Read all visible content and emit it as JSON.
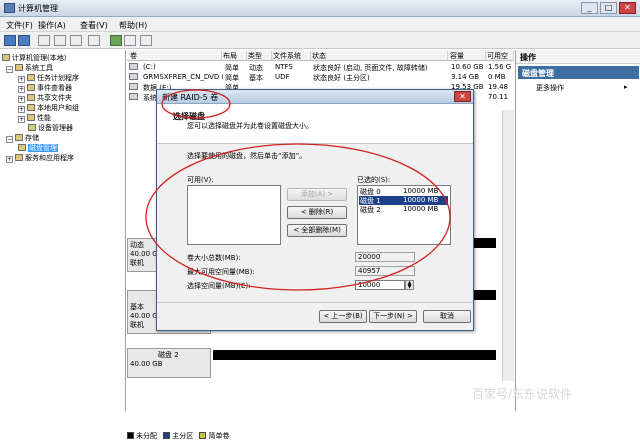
{
  "window": {
    "title": "计算机管理"
  },
  "menu": [
    "文件(F)",
    "操作(A)",
    "查看(V)",
    "帮助(H)"
  ],
  "tree": [
    {
      "label": "计算机管理(本地)",
      "indent": 0,
      "exp": ""
    },
    {
      "label": "系统工具",
      "indent": 1,
      "exp": "−"
    },
    {
      "label": "任务计划程序",
      "indent": 2,
      "exp": "+"
    },
    {
      "label": "事件查看器",
      "indent": 2,
      "exp": "+"
    },
    {
      "label": "共享文件夹",
      "indent": 2,
      "exp": "+"
    },
    {
      "label": "本地用户和组",
      "indent": 2,
      "exp": "+"
    },
    {
      "label": "性能",
      "indent": 2,
      "exp": "+"
    },
    {
      "label": "设备管理器",
      "indent": 2,
      "exp": ""
    },
    {
      "label": "存储",
      "indent": 1,
      "exp": "−"
    },
    {
      "label": "磁盘管理",
      "indent": 2,
      "exp": ""
    },
    {
      "label": "服务和应用程序",
      "indent": 1,
      "exp": "+"
    }
  ],
  "columns": [
    "卷",
    "布局",
    "类型",
    "文件系统",
    "状态",
    "容量",
    "可用空"
  ],
  "volumes": [
    {
      "name": "(C:)",
      "layout": "简单",
      "type": "动态",
      "fs": "NTFS",
      "status": "状态良好 (启动, 页面文件, 故障转储)",
      "cap": "10.60 GB",
      "free": "1.56 G"
    },
    {
      "name": "GRMSXFRER_CN_DVD (D:)",
      "layout": "简单",
      "type": "基本",
      "fs": "UDF",
      "status": "状态良好 (主分区)",
      "cap": "3.14 GB",
      "free": "0 MB"
    },
    {
      "name": "数据 (E:)",
      "layout": "简单",
      "type": "",
      "fs": "",
      "status": "",
      "cap": "19.53 GB",
      "free": "19.48"
    },
    {
      "name": "系统",
      "layout": "",
      "type": "",
      "fs": "",
      "status": "",
      "cap": "",
      "free": "70.11"
    }
  ],
  "disks": [
    {
      "l1": "动态",
      "l2": "40.00 GB",
      "l3": "联机"
    },
    {
      "l1": "基本",
      "l2": "40.00 GB",
      "l3": "联机"
    },
    {
      "l1": "磁盘 2",
      "l2": "",
      "l3": "40.00 GB"
    }
  ],
  "legend": [
    "未分配",
    "主分区",
    "简单卷"
  ],
  "actions": {
    "header": "操作",
    "section": "磁盘管理",
    "item": "更多操作"
  },
  "dialog": {
    "title": "新建 RAID-5 卷",
    "heading": "选择磁盘",
    "subheading": "您可以选择磁盘并为此卷设置磁盘大小。",
    "instruction": "选择要使用的磁盘，然后单击“添加”。",
    "available_label": "可用(V):",
    "selected_label": "已选的(S):",
    "btn_add": "添加(A) >",
    "btn_remove": "< 删除(R)",
    "btn_remove_all": "< 全部删除(M)",
    "selected": [
      {
        "disk": "磁盘 0",
        "size": "10000 MB"
      },
      {
        "disk": "磁盘 1",
        "size": "10000 MB"
      },
      {
        "disk": "磁盘 2",
        "size": "10000 MB"
      }
    ],
    "total_label": "卷大小总数(MB):",
    "total_value": "20000",
    "max_label": "最大可用空间量(MB):",
    "max_value": "40957",
    "select_label": "选择空间量(MB)(E):",
    "select_value": "10000",
    "btn_back": "< 上一步(B)",
    "btn_next": "下一步(N) >",
    "btn_cancel": "取消"
  },
  "watermark": "百家号/东东说软件",
  "colors": {
    "selection": "#1e3f8a",
    "annotation": "#d22020",
    "primary_partition": "#1e3f8a",
    "simple_volume": "#c8c840"
  }
}
